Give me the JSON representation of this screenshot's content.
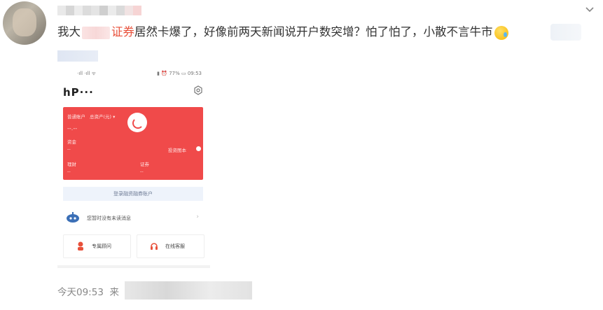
{
  "post": {
    "text_before": "我大",
    "text_red": "证券",
    "text_after": "居然卡爆了，好像前两天新闻说开户数突增？怕了怕了，小散不言牛市",
    "emoji": "crying-face-emoji"
  },
  "phone": {
    "status_left": "·ıll ·ıll ᯤ",
    "status_right": "▮ ⏰ 77% ▭ 09:53",
    "app_title": "hP···",
    "card": {
      "account_type": "普通账户",
      "total_assets_label": "总资产(元) ▾",
      "total_value": "--.--",
      "funds_label": "资金",
      "funds_value": "--",
      "show_details": "投资图本",
      "finance_label": "理财",
      "finance_value": "--",
      "securities_label": "证券",
      "securities_value": "--"
    },
    "login_text": "登录融资融券账户",
    "message_text": "您暂时没有未读消息",
    "advisor_button": "专属顾问",
    "service_button": "在线客服"
  },
  "footer": {
    "time": "今天09:53",
    "source_prefix": "来"
  },
  "colors": {
    "accent_red": "#e8503a",
    "card_red": "#f04a4a"
  }
}
